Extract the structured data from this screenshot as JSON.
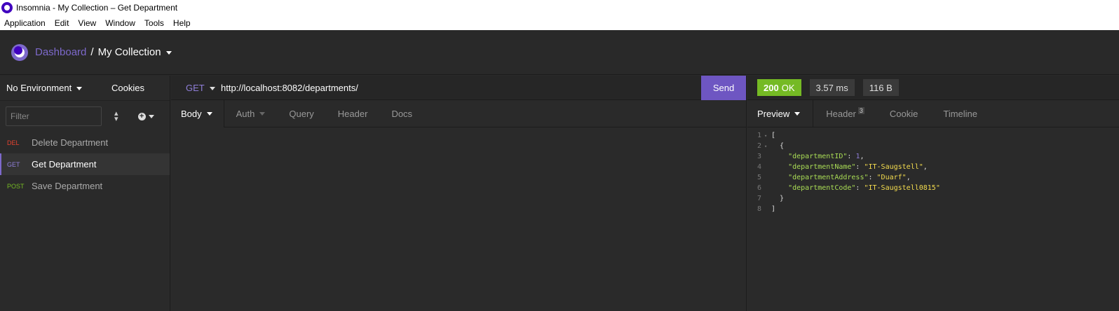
{
  "window": {
    "title": "Insomnia - My Collection – Get Department"
  },
  "menu": [
    "Application",
    "Edit",
    "View",
    "Window",
    "Tools",
    "Help"
  ],
  "header": {
    "dashboard": "Dashboard",
    "separator": "/",
    "collection": "My Collection"
  },
  "sidebar": {
    "environment": "No Environment",
    "cookies": "Cookies",
    "filter_placeholder": "Filter",
    "requests": [
      {
        "method": "DEL",
        "name": "Delete Department"
      },
      {
        "method": "GET",
        "name": "Get Department"
      },
      {
        "method": "POST",
        "name": "Save Department"
      }
    ]
  },
  "request": {
    "method": "GET",
    "url": "http://localhost:8082/departments/",
    "send": "Send",
    "tabs": [
      "Body",
      "Auth",
      "Query",
      "Header",
      "Docs"
    ]
  },
  "response": {
    "status_code": "200",
    "status_text": "OK",
    "time": "3.57 ms",
    "size": "116 B",
    "tabs": [
      "Preview",
      "Header",
      "Cookie",
      "Timeline"
    ],
    "header_count": "3",
    "body_lines": [
      {
        "n": "1",
        "text": "["
      },
      {
        "n": "2",
        "text": "  {"
      },
      {
        "n": "3",
        "key": "\"departmentID\"",
        "value": "1",
        "vtype": "n",
        "comma": ","
      },
      {
        "n": "4",
        "key": "\"departmentName\"",
        "value": "\"IT-Saugstell\"",
        "vtype": "s",
        "comma": ","
      },
      {
        "n": "5",
        "key": "\"departmentAddress\"",
        "value": "\"Duarf\"",
        "vtype": "s",
        "comma": ","
      },
      {
        "n": "6",
        "key": "\"departmentCode\"",
        "value": "\"IT-Saugstell0815\"",
        "vtype": "s",
        "comma": ""
      },
      {
        "n": "7",
        "text": "  }"
      },
      {
        "n": "8",
        "text": "]"
      }
    ]
  },
  "colors": {
    "accent": "#7d69cb",
    "ok": "#75ba24",
    "del": "#e5422f",
    "post": "#75ba24",
    "get": "#8f7ed8"
  }
}
